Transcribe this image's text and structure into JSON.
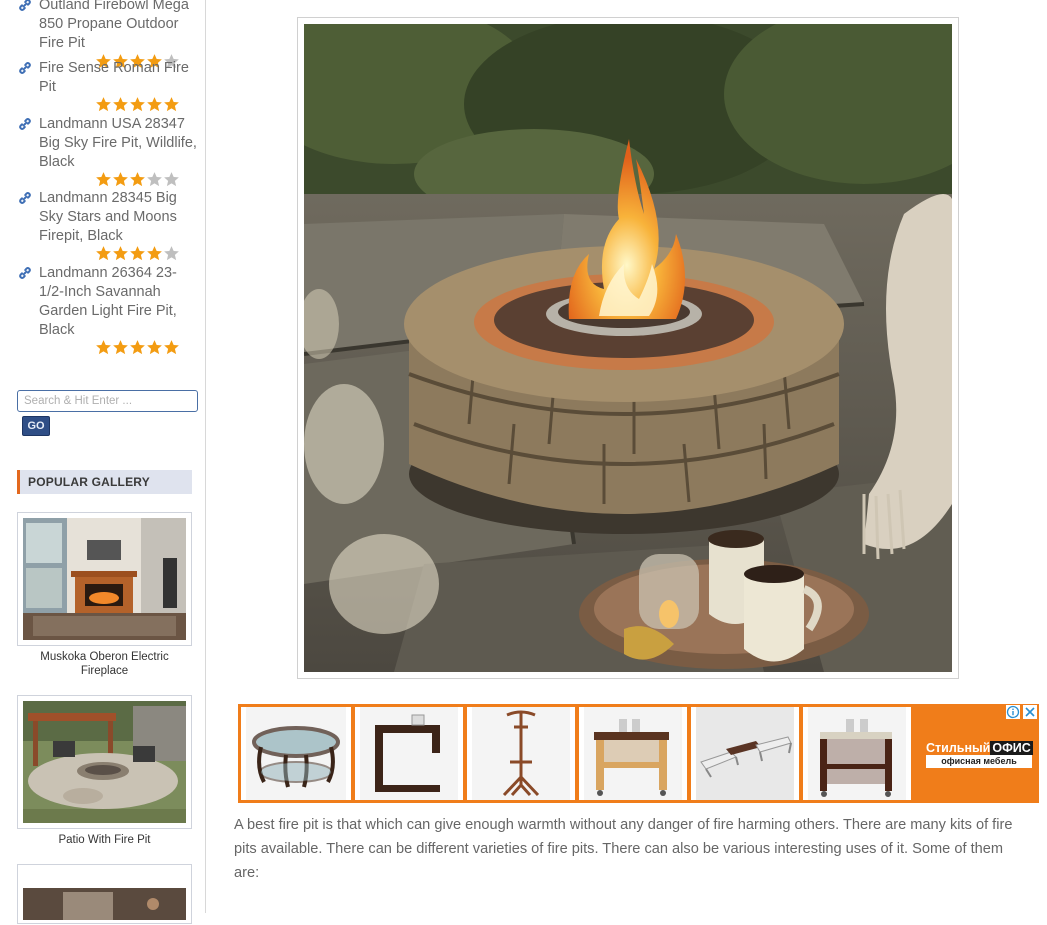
{
  "sidebar": {
    "products": [
      {
        "title": "Outland Firebowl Mega 850 Propane Outdoor Fire Pit",
        "rating": 4
      },
      {
        "title": "Fire Sense Roman Fire Pit",
        "rating": 5
      },
      {
        "title": "Landmann USA 28347 Big Sky Fire Pit, Wildlife, Black",
        "rating": 3
      },
      {
        "title": "Landmann 28345 Big Sky Stars and Moons Firepit, Black",
        "rating": 4
      },
      {
        "title": "Landmann 26364 23-1/2-Inch Savannah Garden Light Fire Pit, Black",
        "rating": 5
      }
    ],
    "search": {
      "placeholder": "Search & Hit Enter ...",
      "button_label": "GO"
    },
    "popular_gallery": {
      "heading": "POPULAR GALLERY",
      "items": [
        {
          "caption": "Muskoka Oberon Electric Fireplace"
        },
        {
          "caption": "Patio With Fire Pit"
        },
        {
          "caption": ""
        }
      ]
    }
  },
  "main": {
    "photo_icon": "fire-pit-photo",
    "ad": {
      "brand_line1": "Стильный",
      "brand_line1_box": "ОФИС",
      "brand_line2": "офисная мебель",
      "accent_color": "#f07d1a"
    },
    "paragraph": "A best fire pit is that which can give enough warmth without any danger of fire harming others. There are many kits of fire pits available. There can be different varieties of fire pits. There can also be various interesting uses of it. Some of them are:"
  },
  "colors": {
    "star": "#f39c12",
    "star_empty": "#bfbfbf",
    "link_icon": "#3f6fb5"
  }
}
